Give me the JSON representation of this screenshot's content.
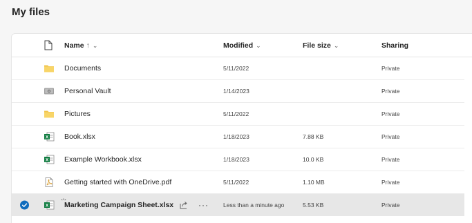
{
  "page": {
    "title": "My files"
  },
  "columns": {
    "name": "Name",
    "sort_arrow": "↑",
    "modified": "Modified",
    "file_size": "File size",
    "sharing": "Sharing"
  },
  "files": [
    {
      "name": "Documents",
      "icon": "folder-icon",
      "modified": "5/11/2022",
      "size": "",
      "sharing": "Private"
    },
    {
      "name": "Personal Vault",
      "icon": "vault-icon",
      "modified": "1/14/2023",
      "size": "",
      "sharing": "Private"
    },
    {
      "name": "Pictures",
      "icon": "folder-icon",
      "modified": "5/11/2022",
      "size": "",
      "sharing": "Private"
    },
    {
      "name": "Book.xlsx",
      "icon": "excel-icon",
      "modified": "1/18/2023",
      "size": "7.88 KB",
      "sharing": "Private"
    },
    {
      "name": "Example Workbook.xlsx",
      "icon": "excel-icon",
      "modified": "1/18/2023",
      "size": "10.0 KB",
      "sharing": "Private"
    },
    {
      "name": "Getting started with OneDrive.pdf",
      "icon": "pdf-icon",
      "modified": "5/11/2022",
      "size": "1.10 MB",
      "sharing": "Private"
    },
    {
      "name": "Marketing Campaign Sheet.xlsx",
      "icon": "excel-icon",
      "modified": "Less than a minute ago",
      "size": "5.53 KB",
      "sharing": "Private",
      "selected": true
    }
  ],
  "colors": {
    "folder": "#f1c44d",
    "excel": "#107c41",
    "accent": "#0f6cbd",
    "selected_row": "#e7e7e7"
  }
}
